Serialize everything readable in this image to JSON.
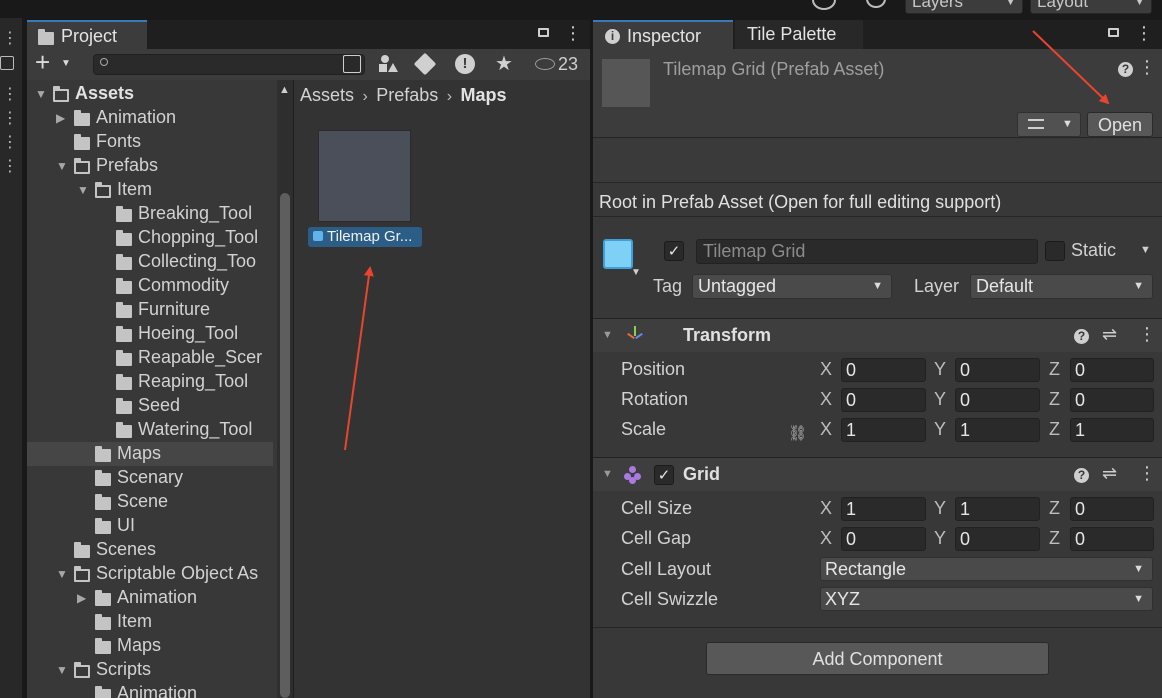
{
  "toolbar": {
    "layers_label": "Layers",
    "layout_label": "Layout"
  },
  "project": {
    "tab_label": "Project",
    "hidden_count": "23",
    "search_placeholder": "",
    "breadcrumb": [
      "Assets",
      "Prefabs",
      "Maps"
    ],
    "tree": [
      {
        "label": "Assets",
        "depth": 0,
        "arrow": "open",
        "open": true,
        "bold": true
      },
      {
        "label": "Animation",
        "depth": 1,
        "arrow": "closed"
      },
      {
        "label": "Fonts",
        "depth": 1,
        "arrow": "none"
      },
      {
        "label": "Prefabs",
        "depth": 1,
        "arrow": "open",
        "open": true
      },
      {
        "label": "Item",
        "depth": 2,
        "arrow": "open",
        "open": true
      },
      {
        "label": "Breaking_Tool",
        "depth": 3,
        "arrow": "none"
      },
      {
        "label": "Chopping_Tool",
        "depth": 3,
        "arrow": "none"
      },
      {
        "label": "Collecting_Too",
        "depth": 3,
        "arrow": "none"
      },
      {
        "label": "Commodity",
        "depth": 3,
        "arrow": "none"
      },
      {
        "label": "Furniture",
        "depth": 3,
        "arrow": "none"
      },
      {
        "label": "Hoeing_Tool",
        "depth": 3,
        "arrow": "none"
      },
      {
        "label": "Reapable_Scer",
        "depth": 3,
        "arrow": "none"
      },
      {
        "label": "Reaping_Tool",
        "depth": 3,
        "arrow": "none"
      },
      {
        "label": "Seed",
        "depth": 3,
        "arrow": "none"
      },
      {
        "label": "Watering_Tool",
        "depth": 3,
        "arrow": "none"
      },
      {
        "label": "Maps",
        "depth": 2,
        "arrow": "none",
        "selected": true
      },
      {
        "label": "Scenary",
        "depth": 2,
        "arrow": "none"
      },
      {
        "label": "Scene",
        "depth": 2,
        "arrow": "none"
      },
      {
        "label": "UI",
        "depth": 2,
        "arrow": "none"
      },
      {
        "label": "Scenes",
        "depth": 1,
        "arrow": "none"
      },
      {
        "label": "Scriptable Object As",
        "depth": 1,
        "arrow": "open",
        "open": true
      },
      {
        "label": "Animation",
        "depth": 2,
        "arrow": "closed"
      },
      {
        "label": "Item",
        "depth": 2,
        "arrow": "none"
      },
      {
        "label": "Maps",
        "depth": 2,
        "arrow": "none"
      },
      {
        "label": "Scripts",
        "depth": 1,
        "arrow": "open",
        "open": true
      },
      {
        "label": "Animation",
        "depth": 2,
        "arrow": "none"
      }
    ],
    "asset": {
      "label": "Tilemap Gr..."
    }
  },
  "inspector": {
    "tabs": [
      "Inspector",
      "Tile Palette"
    ],
    "header_title": "Tilemap Grid (Prefab Asset)",
    "open_button": "Open",
    "root_note": "Root in Prefab Asset (Open for full editing support)",
    "name_value": "Tilemap Grid",
    "static_label": "Static",
    "tag_label": "Tag",
    "tag_value": "Untagged",
    "layer_label": "Layer",
    "layer_value": "Default",
    "transform": {
      "title": "Transform",
      "rows": [
        {
          "label": "Position",
          "x": "0",
          "y": "0",
          "z": "0"
        },
        {
          "label": "Rotation",
          "x": "0",
          "y": "0",
          "z": "0"
        },
        {
          "label": "Scale",
          "x": "1",
          "y": "1",
          "z": "1"
        }
      ]
    },
    "grid": {
      "title": "Grid",
      "rows": [
        {
          "label": "Cell Size",
          "x": "1",
          "y": "1",
          "z": "0"
        },
        {
          "label": "Cell Gap",
          "x": "0",
          "y": "0",
          "z": "0"
        }
      ],
      "cell_layout_label": "Cell Layout",
      "cell_layout_value": "Rectangle",
      "cell_swizzle_label": "Cell Swizzle",
      "cell_swizzle_value": "XYZ"
    },
    "add_component": "Add Component",
    "axis": {
      "x": "X",
      "y": "Y",
      "z": "Z"
    }
  },
  "colors": {
    "accent": "#3a79bb",
    "annotation_arrow": "#e8452f",
    "selected_asset": "#2c5d87"
  }
}
